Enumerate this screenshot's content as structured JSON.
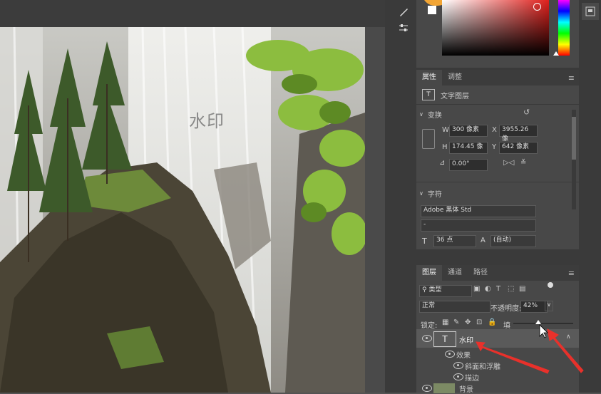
{
  "canvas": {
    "watermark_text": "水印"
  },
  "properties_panel": {
    "tabs": [
      "属性",
      "调整"
    ],
    "layer_kind": "文字图层",
    "transform": {
      "section_title": "变换",
      "w_label": "W",
      "w_value": "300 像素",
      "x_label": "X",
      "x_value": "3955.26 像",
      "h_label": "H",
      "h_value": "174.45 像",
      "y_label": "Y",
      "y_value": "642 像素",
      "angle_value": "0.00°"
    },
    "character": {
      "section_title": "字符",
      "font_family": "Adobe 黑体 Std",
      "font_style": "-",
      "font_size": "36 点",
      "leading": "(自动)"
    }
  },
  "layers_panel": {
    "tabs": [
      "图层",
      "通道",
      "路径"
    ],
    "filter_kind": "类型",
    "blend_mode": "正常",
    "opacity_label": "不透明度:",
    "opacity_value": "42%",
    "lock_label": "锁定:",
    "fill_label": "填",
    "fill_slider_percent": 42,
    "layers": [
      {
        "name": "水印",
        "effects_label": "效果",
        "effects": [
          "斜面和浮雕",
          "描边"
        ]
      },
      {
        "name": "背景"
      }
    ]
  },
  "colors": {
    "accent_red": "#e8312b",
    "panel_bg": "#484848"
  }
}
